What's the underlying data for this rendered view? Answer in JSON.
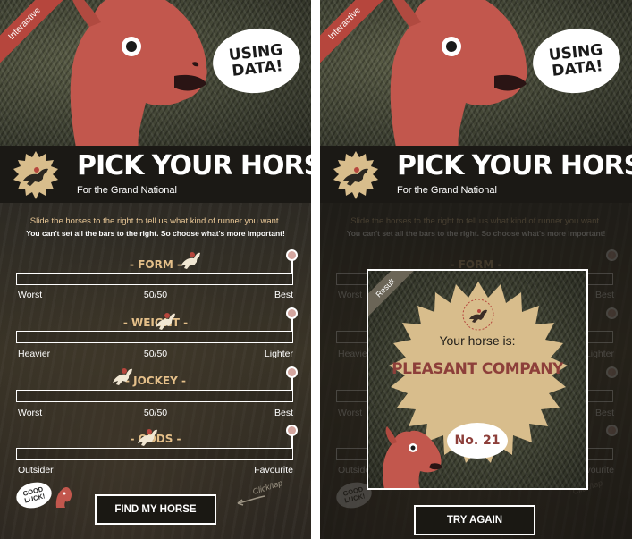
{
  "header": {
    "ribbon_label": "Interactive",
    "speech_bubble_line1": "USING",
    "speech_bubble_line2": "DATA!",
    "title": "PICK YOUR HORSE",
    "subtitle": "For the Grand National"
  },
  "instructions": {
    "line1": "Slide the horses to the right to tell us what kind of runner you want.",
    "line2": "You can't set all the bars to the right. So choose what's more important!"
  },
  "sliders": [
    {
      "label": "- FORM -",
      "left": "Worst",
      "center": "50/50",
      "right": "Best",
      "value": 1.0
    },
    {
      "label": "- WEIGHT -",
      "left": "Heavier",
      "center": "50/50",
      "right": "Lighter",
      "value": 1.0
    },
    {
      "label": "- JOCKEY -",
      "left": "Worst",
      "center": "50/50",
      "right": "Best",
      "value": 1.0
    },
    {
      "label": "- ODDS -",
      "left": "Outsider",
      "center": "",
      "right": "Favourite",
      "value": 1.0
    }
  ],
  "footer": {
    "good_luck_line1": "GOOD",
    "good_luck_line2": "LUCK!",
    "click_tap": "Click/tap",
    "cta_label": "FIND MY HORSE"
  },
  "result": {
    "tag": "Result",
    "heading": "Your horse is:",
    "horse_name": "PLEASANT COMPANY",
    "number": "No. 21",
    "try_again_label": "TRY AGAIN"
  },
  "colors": {
    "accent_red": "#b6463d",
    "gold": "#e5c08a",
    "seal_tan": "#d8bd8c",
    "horse_name": "#8d3f3a"
  }
}
